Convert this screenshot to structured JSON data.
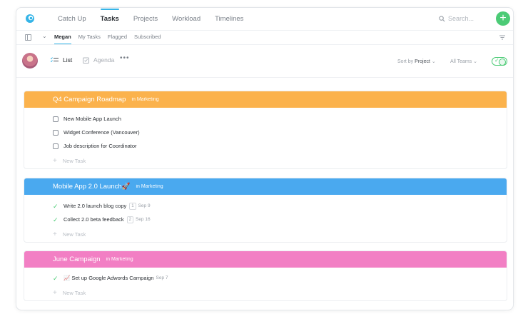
{
  "nav": {
    "tabs": [
      {
        "label": "Catch Up"
      },
      {
        "label": "Tasks"
      },
      {
        "label": "Projects"
      },
      {
        "label": "Workload"
      },
      {
        "label": "Timelines"
      }
    ],
    "search_placeholder": "Search...",
    "add_label": "+"
  },
  "subnav": {
    "tabs": [
      {
        "label": "Megan"
      },
      {
        "label": "My Tasks"
      },
      {
        "label": "Flagged"
      },
      {
        "label": "Subscribed"
      }
    ]
  },
  "toolbar": {
    "list_label": "List",
    "agenda_label": "Agenda",
    "more_label": "•••",
    "sort_prefix": "Sort by",
    "sort_value": "Project",
    "teams_label": "All Teams",
    "toggle_checked": true
  },
  "colors": {
    "accent": "#35b4e7",
    "add_green": "#4ccb76",
    "project_orange": "#fbb24c",
    "project_blue": "#4aa9ef",
    "project_pink": "#f27fc4"
  },
  "projects": [
    {
      "title": "Q4 Campaign Roadmap",
      "team": "in Marketing",
      "color": "#fbb24c",
      "tasks": [
        {
          "name": "New Mobile App Launch",
          "done": false
        },
        {
          "name": "Widget Conference (Vancouver)",
          "done": false
        },
        {
          "name": "Job description for Coordinator",
          "done": false
        }
      ],
      "new_task_label": "New Task"
    },
    {
      "title": "Mobile App 2.0 Launch🚀",
      "team": "in Marketing",
      "color": "#4aa9ef",
      "tasks": [
        {
          "name": "Write 2.0 launch blog copy",
          "done": true,
          "count": "1",
          "date": "Sep 9"
        },
        {
          "name": "Collect 2.0 beta feedback",
          "done": true,
          "count": "2",
          "date": "Sep 16"
        }
      ],
      "new_task_label": "New Task"
    },
    {
      "title": "June Campaign",
      "team": "in Marketing",
      "color": "#f27fc4",
      "tasks": [
        {
          "name": "📈 Set up Google Adwords Campaign",
          "done": true,
          "date": "Sep 7"
        }
      ],
      "new_task_label": "New Task"
    }
  ]
}
